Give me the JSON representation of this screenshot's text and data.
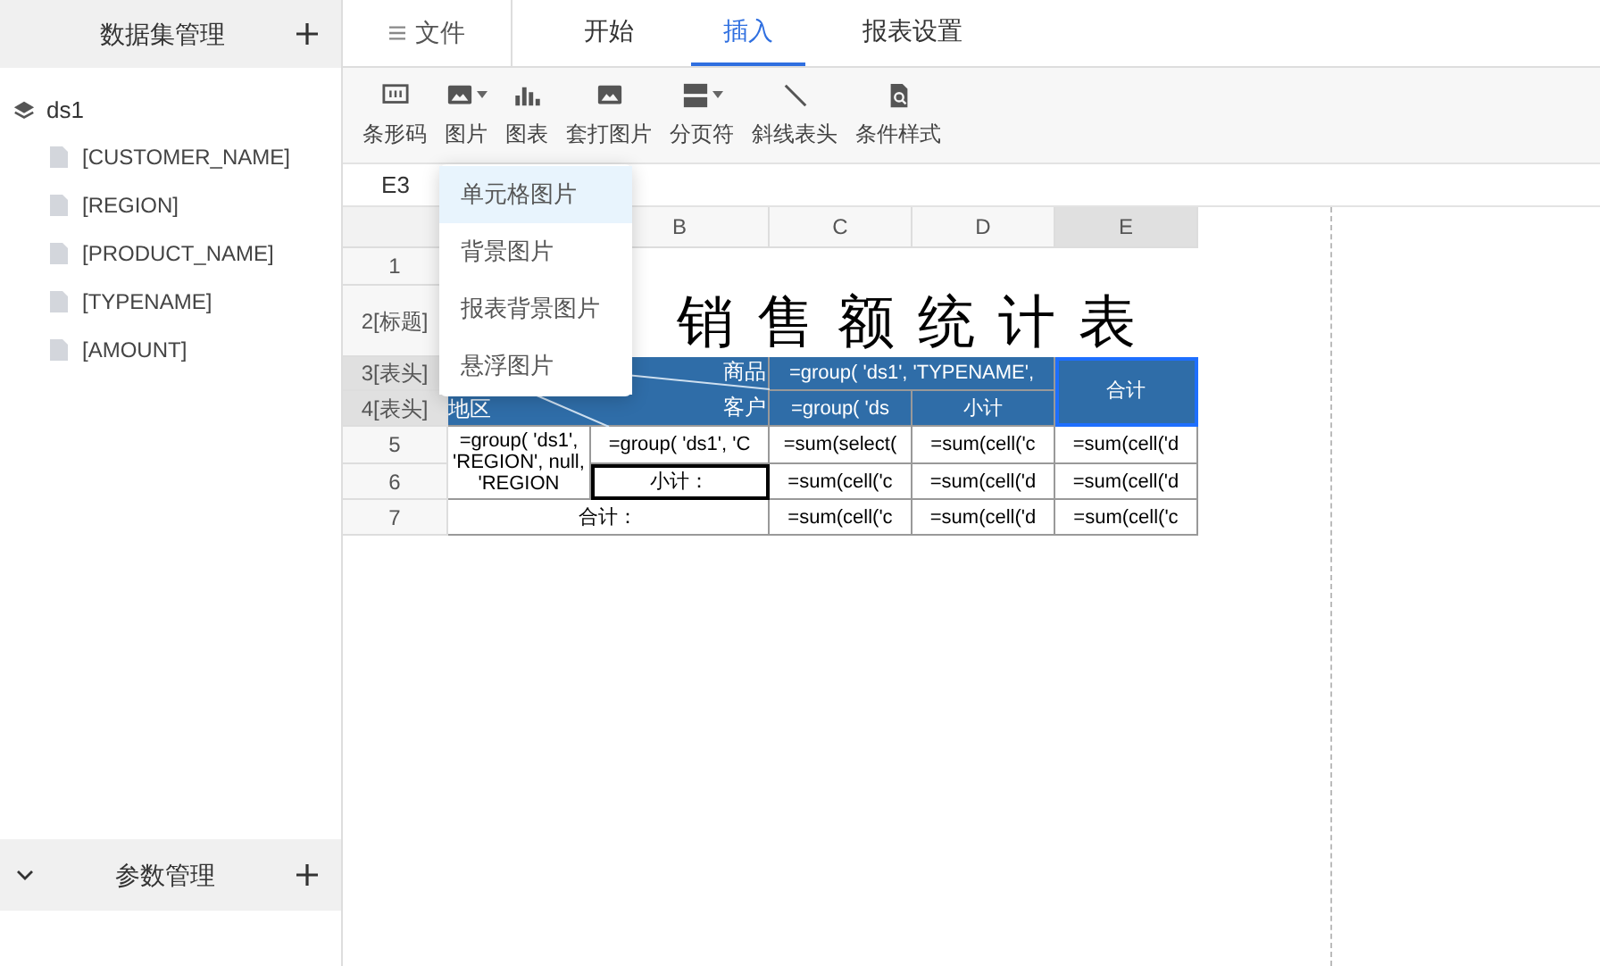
{
  "sidebar": {
    "title": "数据集管理",
    "datasets": [
      {
        "name": "ds1",
        "fields": [
          "[CUSTOMER_NAME]",
          "[REGION]",
          "[PRODUCT_NAME]",
          "[TYPENAME]",
          "[AMOUNT]"
        ]
      }
    ]
  },
  "param_panel": {
    "title": "参数管理"
  },
  "file_menu": "文件",
  "tabs": [
    {
      "label": "开始",
      "selected": false
    },
    {
      "label": "插入",
      "selected": true
    },
    {
      "label": "报表设置",
      "selected": false
    }
  ],
  "toolbar": [
    {
      "kind": "barcode",
      "label": "条形码",
      "dropdown": false
    },
    {
      "kind": "image",
      "label": "图片",
      "dropdown": true
    },
    {
      "kind": "chart",
      "label": "图表",
      "dropdown": false
    },
    {
      "kind": "image",
      "label": "套打图片",
      "dropdown": false
    },
    {
      "kind": "pagebreak",
      "label": "分页符",
      "dropdown": true
    },
    {
      "kind": "slash",
      "label": "斜线表头",
      "dropdown": false
    },
    {
      "kind": "condition",
      "label": "条件样式",
      "dropdown": false
    }
  ],
  "dropdown_menu": [
    {
      "label": "单元格图片",
      "selected": true
    },
    {
      "label": "背景图片",
      "selected": false
    },
    {
      "label": "报表背景图片",
      "selected": false
    },
    {
      "label": "悬浮图片",
      "selected": false
    }
  ],
  "cell_ref": "E3",
  "columns": [
    {
      "label": "B",
      "selected": false
    },
    {
      "label": "C",
      "selected": false
    },
    {
      "label": "D",
      "selected": false
    },
    {
      "label": "E",
      "selected": true
    }
  ],
  "rows": [
    {
      "label": "1",
      "selected": false
    },
    {
      "label": "2[标题]",
      "selected": false
    },
    {
      "label": "3[表头]",
      "selected": true
    },
    {
      "label": "4[表头]",
      "selected": true
    },
    {
      "label": "5",
      "selected": false
    },
    {
      "label": "6",
      "selected": false
    },
    {
      "label": "7",
      "selected": false
    }
  ],
  "report_title": "销售额统计表",
  "diagonal_header": {
    "top": "商品",
    "middle": "客户",
    "bottom": "地区"
  },
  "cells": [
    {
      "kind": "header",
      "text": "=group( 'ds1', 'TYPENAME',",
      "selected": false
    },
    {
      "kind": "header",
      "text": "合计",
      "selected": true
    },
    {
      "kind": "header",
      "text": "=group( 'ds",
      "selected": false
    },
    {
      "kind": "header",
      "text": "小计",
      "selected": false
    },
    {
      "kind": "body",
      "text": "=group( 'ds1', 'REGION', null, 'REGION",
      "selected": false
    },
    {
      "kind": "body",
      "text": "=group( 'ds1', 'C",
      "selected": false
    },
    {
      "kind": "body",
      "text": "=sum(select(",
      "selected": false
    },
    {
      "kind": "body",
      "text": "=sum(cell('c",
      "selected": false
    },
    {
      "kind": "body",
      "text": "=sum(cell('d",
      "selected": false
    },
    {
      "kind": "body",
      "text": "小计：",
      "selected": true
    },
    {
      "kind": "body",
      "text": "=sum(cell('c",
      "selected": false
    },
    {
      "kind": "body",
      "text": "=sum(cell('d",
      "selected": false
    },
    {
      "kind": "body",
      "text": "=sum(cell('d",
      "selected": false
    },
    {
      "kind": "body",
      "text": "合计：",
      "selected": false
    },
    {
      "kind": "body",
      "text": "=sum(cell('c",
      "selected": false
    },
    {
      "kind": "body",
      "text": "=sum(cell('d",
      "selected": false
    },
    {
      "kind": "body",
      "text": "=sum(cell('c",
      "selected": false
    }
  ]
}
